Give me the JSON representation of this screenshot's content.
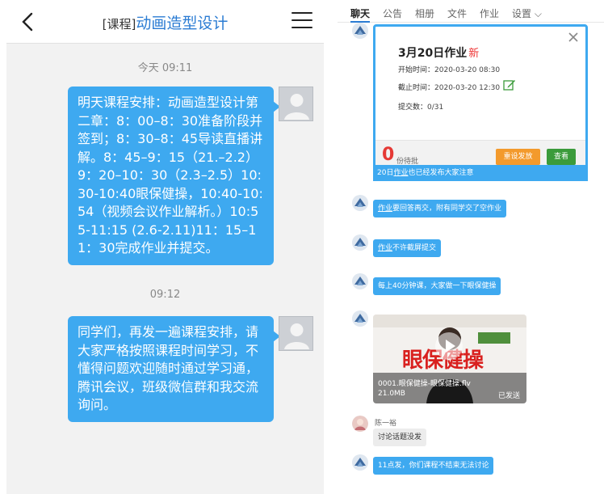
{
  "left": {
    "header": {
      "tag": "[课程]",
      "title": "动画造型设计"
    },
    "messages": [
      {
        "time": "今天 09:11",
        "text": "明天课程安排：动画造型设计第二章：8：00–8：30准备阶段并签到；8：30–8：45导读直播讲解。8：45–9：15（21.–2.2）9：20–10：30（2.3–2.5）10:30-10:40眼保健操，10:40-10:54（视频会议作业解析。）10:55-11:15 (2.6-2.11)11：15–11：30完成作业并提交。"
      },
      {
        "time": "09:12",
        "text": "同学们，再发一遍课程安排，请大家严格按照课程时间学习，不懂得问题欢迎随时通过学习通，腾讯会议，班级微信群和我交流询问。"
      }
    ]
  },
  "right": {
    "tabs": [
      "聊天",
      "公告",
      "相册",
      "文件",
      "作业",
      "设置 ⌵"
    ],
    "homework": {
      "title": "3月20日作业",
      "new_label": "新",
      "start_label": "开始时间：",
      "start_value": "2020-03-20 08:30",
      "end_label": "截止时间：",
      "end_value": "2020-03-20 12:30",
      "submit_label": "提交数：",
      "submit_value": "0/31",
      "pending_count": "0",
      "pending_label": "份待批",
      "resend_label": "重设发放",
      "view_label": "查看",
      "note_prefix": "20日",
      "note_link": "作业",
      "note_suffix": "也已经发布大家注意"
    },
    "msg1": {
      "link": "作业",
      "text": "要回答再交，附有同学交了空作业"
    },
    "msg2": {
      "link": "作业",
      "text": "不许截屏提交"
    },
    "msg3": "每上40分钟课，大家做一下眼保健操",
    "video": {
      "overlay_title": "眼保健操",
      "filename": "0001.眼保健操-眼保健操.flv",
      "size": "21.0MB",
      "status": "已发送"
    },
    "user_name": "陈一裕",
    "msg4": "讨论话题没发",
    "msg5": "11点发，你们课程不结束无法讨论",
    "colors": {
      "bubble": "#3ea9f0",
      "accent": "#2b7cd3",
      "alert": "#e53935",
      "resend": "#f39a2c",
      "view": "#3b9b3b"
    }
  }
}
